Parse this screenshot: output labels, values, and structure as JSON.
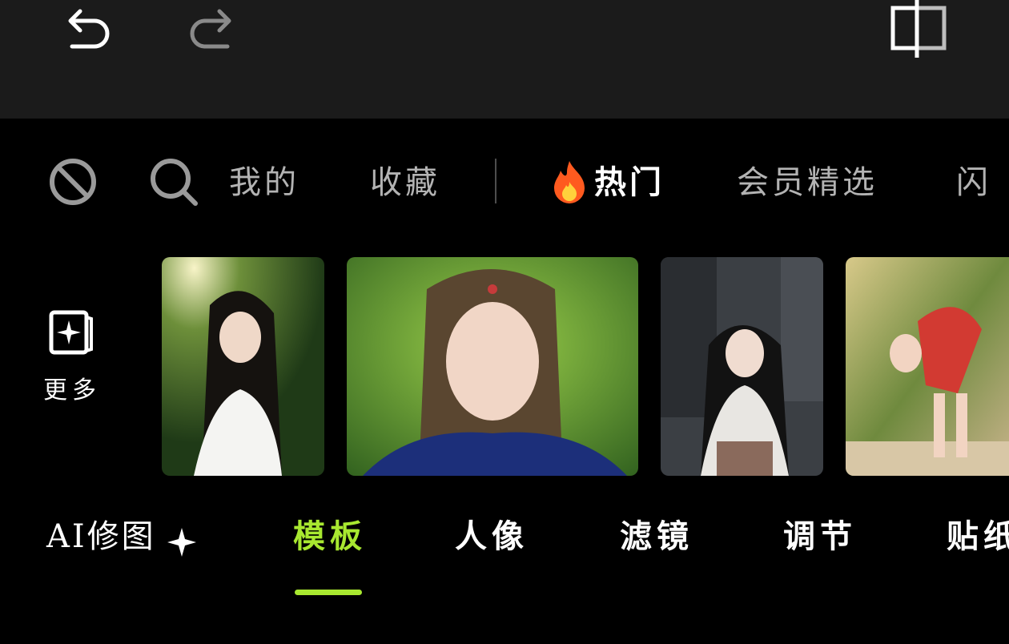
{
  "toolbar": {
    "undo_icon": "undo-icon",
    "redo_icon": "redo-icon",
    "compare_icon": "compare-icon"
  },
  "categories": {
    "items": [
      {
        "label": "我的",
        "icon": null
      },
      {
        "label": "收藏",
        "icon": null
      },
      {
        "label": "热门",
        "icon": "fire-icon",
        "active": true
      },
      {
        "label": "会员精选",
        "icon": null
      },
      {
        "label": "闪"
      }
    ],
    "none_icon": "no-effect-icon",
    "search_icon": "search-icon"
  },
  "templates": {
    "more_label": "更多",
    "more_icon": "sparkle-frame-icon"
  },
  "bottom_tabs": {
    "items": [
      {
        "label": "AI修图",
        "icon": "sparkle-icon"
      },
      {
        "label": "模板",
        "active": true
      },
      {
        "label": "人像"
      },
      {
        "label": "滤镜"
      },
      {
        "label": "调节"
      },
      {
        "label": "贴纸"
      }
    ]
  },
  "colors": {
    "accent": "#a8e830",
    "toolbar_bg": "#1b1b1b",
    "background": "#000000"
  }
}
